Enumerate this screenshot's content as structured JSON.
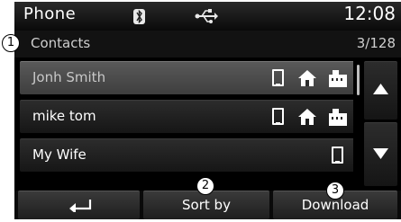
{
  "status_bar": {
    "title": "Phone",
    "clock": "12:08",
    "bluetooth_icon": "bluetooth-icon",
    "usb_icon": "usb-icon"
  },
  "subheader": {
    "label": "Contacts",
    "count": "3/128"
  },
  "contacts": [
    {
      "name": "Jonh Smith",
      "icons": [
        "mobile-phone-icon",
        "home-icon",
        "work-icon"
      ],
      "selected": true
    },
    {
      "name": "mike tom",
      "icons": [
        "mobile-phone-icon",
        "home-icon",
        "work-icon"
      ],
      "selected": false
    },
    {
      "name": "My Wife",
      "icons": [
        "mobile-phone-icon"
      ],
      "selected": false
    }
  ],
  "scroll": {
    "up_icon": "arrow-up-icon",
    "down_icon": "arrow-down-icon"
  },
  "bottom_bar": {
    "back_icon": "back-icon",
    "sort_label": "Sort by",
    "download_label": "Download"
  },
  "callouts": [
    "1",
    "2",
    "3"
  ],
  "colors": {
    "screen_bg": "#000000",
    "text": "#ffffff",
    "selected_row": "#4a4a4a"
  }
}
